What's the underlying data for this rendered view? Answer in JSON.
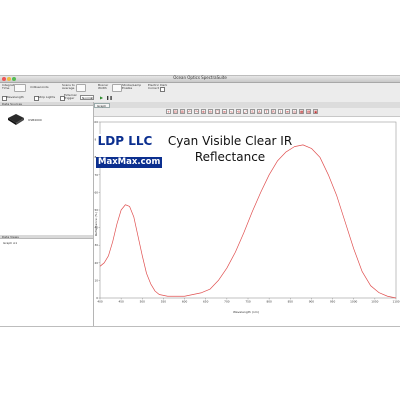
{
  "window": {
    "title": "Ocean Optics SpectraSuite"
  },
  "toolbar": {
    "row1": [
      {
        "label": "Integration\nTime",
        "value": ""
      },
      {
        "label": "milliseconds"
      },
      {
        "label": "Scans to\nAverage"
      },
      {
        "label": "Boxcar\nWidth"
      },
      {
        "label": "Strobe/Lamp\nEnable"
      },
      {
        "label": "Electric Dark\nCorrect"
      }
    ],
    "row2": [
      {
        "label": "Wavelength"
      },
      {
        "label": "Strip Lights"
      },
      {
        "label": "External\nTrigger"
      },
      {
        "label": "Normal"
      }
    ]
  },
  "left_panel": {
    "top_header": "Data Sources",
    "device_label": "USB4000",
    "bottom_header": "Data Views",
    "bottom_item": "Graph A1"
  },
  "tab": {
    "label": "Graph A1"
  },
  "plot_buttons": [
    "+",
    "⊟",
    "⊞",
    "↶",
    "↷",
    "⊕",
    "⊖",
    "□",
    "≡",
    "∿",
    "⟲",
    "⤢",
    "S",
    "A",
    "T",
    "R",
    "I",
    "≋",
    "◎",
    "▦",
    "▤",
    "▣"
  ],
  "overlay": {
    "logo_line1": "LDP LLC",
    "logo_line2": "MaxMax.com",
    "title_line1": "Cyan Visible Clear IR",
    "title_line2": "Reflectance"
  },
  "chart_data": {
    "type": "line",
    "xlabel": "Wavelength (nm)",
    "ylabel": "Reflectance (%)",
    "xlim": [
      400,
      1100
    ],
    "ylim": [
      0,
      100
    ],
    "x_ticks": [
      400,
      450,
      500,
      550,
      600,
      650,
      700,
      750,
      800,
      850,
      900,
      950,
      1000,
      1050,
      1100
    ],
    "y_ticks": [
      0,
      10,
      20,
      30,
      40,
      50,
      60,
      70,
      80,
      90,
      100
    ],
    "grid": false,
    "color": "#e05050",
    "series": [
      {
        "x": [
          400,
          410,
          420,
          430,
          440,
          450,
          460,
          470,
          480,
          490,
          500,
          510,
          520,
          530,
          540,
          560,
          580,
          600,
          620,
          640,
          660,
          680,
          700,
          720,
          740,
          760,
          780,
          800,
          820,
          840,
          860,
          880,
          900,
          920,
          940,
          960,
          980,
          1000,
          1020,
          1040,
          1060,
          1080,
          1100
        ],
        "y": [
          18,
          20,
          24,
          32,
          42,
          50,
          53,
          52,
          46,
          35,
          24,
          14,
          8,
          4,
          2,
          1,
          1,
          1,
          2,
          3,
          5,
          10,
          17,
          26,
          37,
          49,
          60,
          70,
          78,
          83,
          86,
          87,
          85,
          80,
          70,
          58,
          43,
          28,
          15,
          7,
          3,
          1,
          0
        ]
      }
    ]
  }
}
